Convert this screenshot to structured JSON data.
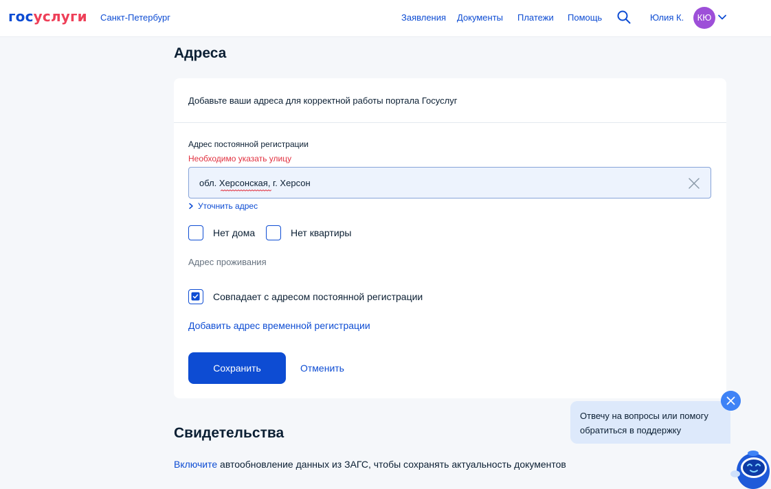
{
  "header": {
    "logo_part1": "гос",
    "logo_part2": "услуги",
    "region": "Санкт-Петербург",
    "nav": [
      "Заявления",
      "Документы",
      "Платежи",
      "Помощь"
    ],
    "user_name": "Юлия К.",
    "avatar_initials": "КЮ",
    "icons": [
      "search-icon",
      "chevron-down-icon"
    ]
  },
  "addresses": {
    "title": "Адреса",
    "intro": "Добавьте ваши адреса для корректной работы портала Госуслуг",
    "registration_label": "Адрес постоянной регистрации",
    "registration_error": "Необходимо указать улицу",
    "registration_value": "обл. Херсонская, г. Херсон",
    "refine_link": "Уточнить адрес",
    "no_house_label": "Нет дома",
    "no_house_checked": false,
    "no_flat_label": "Нет квартиры",
    "no_flat_checked": false,
    "residence_label": "Адрес проживания",
    "same_as_registration_label": "Совпадает с адресом постоянной регистрации",
    "same_as_registration_checked": true,
    "add_temp_link": "Добавить адрес временной регистрации",
    "save_button": "Сохранить",
    "cancel_button": "Отменить"
  },
  "certificates": {
    "title": "Свидетельства",
    "link_text": "Включите",
    "rest_text": " автообновление данных из ЗАГС, чтобы сохранять актуальность документов"
  },
  "assistant": {
    "bubble_text": "Отвечу на вопросы или помогу обратиться в поддержку"
  },
  "colors": {
    "accent": "#0d4cd3",
    "error": "#e1303f",
    "brand_red": "#ee3f58",
    "avatar": "#9d4fd8"
  }
}
